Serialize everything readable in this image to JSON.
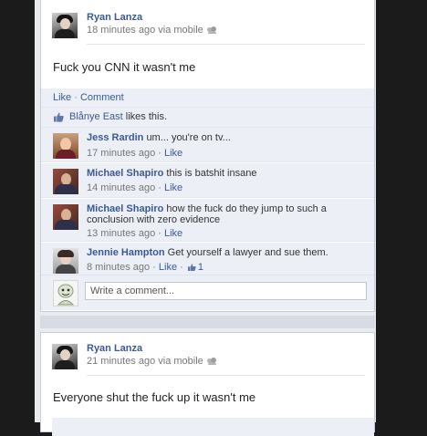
{
  "posts": [
    {
      "author": "Ryan Lanza",
      "meta": "18 minutes ago via mobile",
      "text": "Fuck you CNN it wasn't me",
      "actions": {
        "like": "Like",
        "separator": "·",
        "comment": "Comment"
      },
      "likes": {
        "name": "Blånye East",
        "suffix": "likes this."
      },
      "comments": [
        {
          "author": "Jess Rardin",
          "text": "um... you're on tv...",
          "time": "17 minutes ago",
          "like": "Like"
        },
        {
          "author": "Michael Shapiro",
          "text": "this is batshit insane",
          "time": "14 minutes ago",
          "like": "Like"
        },
        {
          "author": "Michael Shapiro",
          "text": "how the fuck do they jump to such a conclusion with zero evidence",
          "time": "13 minutes ago",
          "like": "Like"
        },
        {
          "author": "Jennie Hampton",
          "text": "Get yourself a lawyer and sue them.",
          "time": "8 minutes ago",
          "like": "Like",
          "like_count": "1"
        }
      ],
      "comment_placeholder": "Write a comment..."
    },
    {
      "author": "Ryan Lanza",
      "meta": "21 minutes ago via mobile",
      "text": "Everyone shut the fuck up it wasn't me"
    }
  ],
  "colors": {
    "link": "#3b5998",
    "panel": "#eceff5",
    "backdrop": "#1b1b1b"
  },
  "icons": [
    "friends-icon",
    "thumbs-up-icon"
  ]
}
